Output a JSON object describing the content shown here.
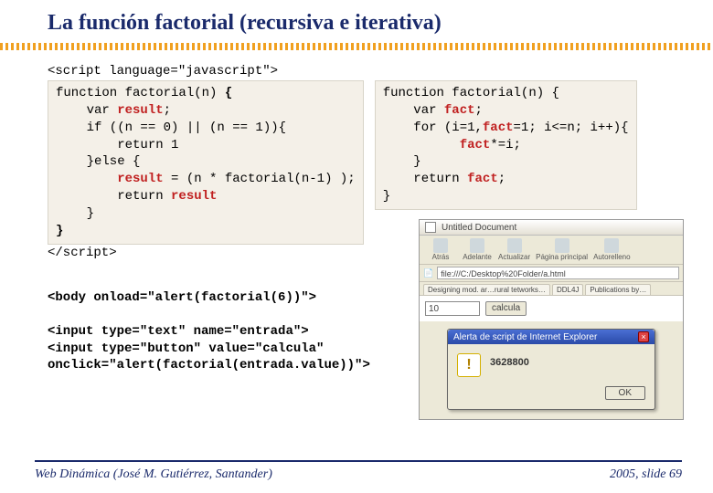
{
  "title": "La función factorial (recursiva e iterativa)",
  "code": {
    "scriptOpen": "<script language=\"javascript\">",
    "scriptClose": "</script>",
    "rec": {
      "l1a": "function factorial(n) ",
      "l1b": "{",
      "l2a": "    var ",
      "l2b": "result",
      "l2c": ";",
      "l3": "    if ((n == 0) || (n == 1)){",
      "l4": "        return 1",
      "l5": "    }else {",
      "l6a": "        ",
      "l6b": "result",
      "l6c": " = (n * factorial(n-1) );",
      "l7a": "        return ",
      "l7b": "result",
      "l8": "    }",
      "l9": "}"
    },
    "it": {
      "l1": "function factorial(n) {",
      "l2a": "    var ",
      "l2b": "fact",
      "l2c": ";",
      "l3a": "    for (i=1,",
      "l3b": "fact",
      "l3c": "=1; i<=n; i++){",
      "l4a": "          ",
      "l4b": "fact",
      "l4c": "*=i;",
      "l5": "    }",
      "l6a": "    return ",
      "l6b": "fact",
      "l6c": ";",
      "l7": "}"
    },
    "bodyLine": "<body onload=\"alert(factorial(6))\">",
    "inputTextLine": "<input type=\"text\" name=\"entrada\">",
    "inputBtnLine1": "<input type=\"button\" value=\"calcula\"",
    "inputBtnLine2": "onclick=\"alert(factorial(entrada.value))\">"
  },
  "browser": {
    "title": "Untitled Document",
    "toolbar": [
      "Atrás",
      "Adelante",
      "Actualizar",
      "Página principal",
      "Autorelleno"
    ],
    "url": "file:///C:/Desktop%20Folder/a.html",
    "tabs": [
      "Designing mod. ar…rural tetworks…",
      "DDL4J",
      "Publications by…"
    ],
    "webInput": "10",
    "webBtn": "calcula",
    "dialogTitle": "Alerta de script de Internet Explorer",
    "dialogMsg": "3628800",
    "dialogOk": "OK"
  },
  "footer": {
    "left": "Web Dinámica (José M. Gutiérrez, Santander)",
    "right": "2005, slide 69"
  }
}
